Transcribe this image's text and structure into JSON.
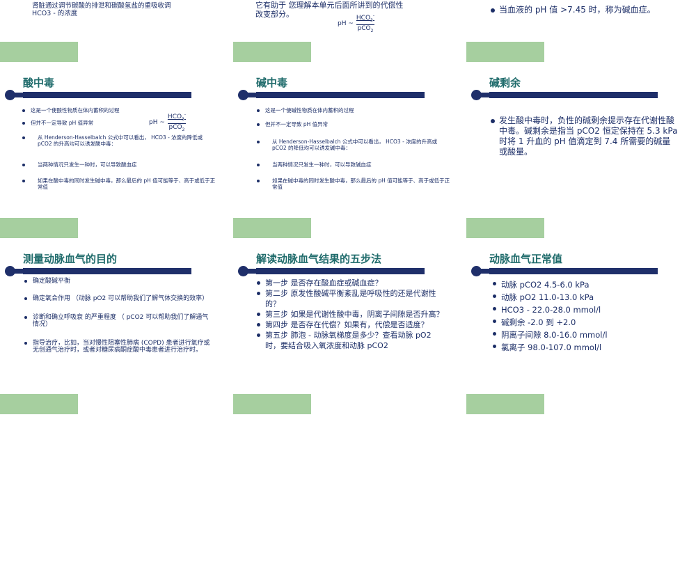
{
  "colors": {
    "accent_green": "#a6cf9f",
    "title_teal": "#1f6b6b",
    "bar_navy": "#1f2f6a",
    "text_navy": "#1c2e67"
  },
  "top_partial": {
    "s1": {
      "line1": "肾脏通过调节碳酸的排泄和碳酸氢盐的重吸收调",
      "line2": "HCO3 -   的浓度"
    },
    "s2": {
      "line1": "它有助于  您理解本单元后面所讲到的代偿性",
      "line2": "改变部分。",
      "formula_ph": "pH ~",
      "formula_num": "HCO",
      "formula_sub": "3",
      "formula_sup": "-",
      "formula_den": "pCO",
      "formula_den_sub": "2"
    },
    "s3": {
      "line1": "当血液的 pH  值 >7.45  时，称为碱血症。"
    }
  },
  "row1": {
    "s1": {
      "title": "酸中毒",
      "items": [
        "这是一个使酸性物质在体内蓄积的过程",
        "但并不一定导致 pH  值异常",
        "从 Henderson-Hasselbalch  公式中可以看出，  HCO3 -  浓度的降低或 pCO2   的升高均可以诱发酸中毒：",
        "当两种情况只发生一种时，可以导致酸血症",
        "如果在酸中毒的同时发生碱中毒，那么最后的 pH  值可能等于、高于或低于正常值"
      ],
      "formula_ph": "pH ~",
      "formula_num": "HCO",
      "formula_sub": "3",
      "formula_sup": "-",
      "formula_den": "pCO",
      "formula_den_sub": "2"
    },
    "s2": {
      "title": "碱中毒",
      "items": [
        "这是一个使碱性物质在体内蓄积的过程",
        "但并不一定导致 pH  值异常",
        "从 Henderson-Hasselbalch  公式中可以看出，  HCO3 -  浓度的升高或 pCO2   的降低均可以诱发碱中毒：",
        "当两种情况只发生一种时，可以导致碱血症",
        "如果在碱中毒的同时发生酸中毒，那么最后的 pH  值可能等于、高于或低于正常值"
      ]
    },
    "s3": {
      "title": "碱剩余",
      "items": [
        "发生酸中毒时，负性的碱剩余提示存在代谢性酸中毒。碱剩余是指当 pCO2  恒定保持在 5.3 kPa  时将 1  升血的 pH  值滴定到 7.4  所需要的碱量或酸量。"
      ]
    }
  },
  "row2": {
    "s1": {
      "title": "测量动脉血气的目的",
      "items": [
        "确定酸碱平衡",
        "确定氧合作用   （动脉 pO2  可以帮助我们了解气体交换的效率）",
        "诊断和确立呼吸衰  的严重程度   （  pCO2   可以帮助我们了解通气情况）",
        "指导治疗，比如，当对慢性阻塞性肺病 (COPD)  患者进行氧疗或无创通气治疗时，或者对糖尿病酮症酸中毒患者进行治疗时。"
      ]
    },
    "s2": {
      "title": "解读动脉血气结果的五步法",
      "items": [
        "第一步      是否存在酸血症或碱血症？",
        "第二步      原发性酸碱平衡紊乱是呼吸性的还是代谢性的？",
        "第三步      如果是代谢性酸中毒，阴离子间隙是否升高？",
        "第四步      是否存在代偿？如果有，代偿是否适度？",
        "第五步      肺泡 - 动脉氧梯度是多少？查看动脉 pO2   时，要结合吸入氧浓度和动脉 pCO2"
      ]
    },
    "s3": {
      "title": "动脉血气正常值",
      "items": [
        "动脉 pCO2   4.5-6.0 kPa",
        "动脉 pO2     11.0-13.0 kPa",
        "HCO3 -      22.0-28.0 mmol/l",
        "碱剩余           -2.0  到 +2.0",
        "阴离子间隙 8.0-16.0 mmol/l",
        "氯离子         98.0-107.0 mmol/l"
      ]
    }
  }
}
